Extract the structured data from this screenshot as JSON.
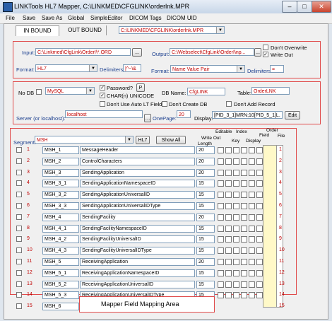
{
  "window": {
    "title": "LINKTools HL7 Mapper, C:\\LINKMED\\CFGLINK\\orderlnk.MPR"
  },
  "menu": [
    "File",
    "Save",
    "Save As",
    "Global",
    "SimpleEditor",
    "DICOM Tags",
    "DICOM UID"
  ],
  "tabs": {
    "inbound": "IN BOUND",
    "outbound": "OUT BOUND"
  },
  "file_path": "C:\\LINKMED\\CFGLINK\\orderlnk.MPR",
  "input": {
    "label": "Input:",
    "value": "C:\\Linkmed\\CfgLink\\OrderI\\*.ORD",
    "browse": "...",
    "format_label": "Format:",
    "format_value": "HL7",
    "delim_label": "Delimiters:",
    "delim_value": "|^~\\&"
  },
  "output": {
    "label": "Output:",
    "value": "C:\\Webselect\\CfgLink\\OrderI\\np...",
    "browse": "...",
    "dont_overwrite": "Don't Overwrite",
    "write_out": "Write Out",
    "format_label": "Format:",
    "format_value": "Name Value Pair",
    "delim_label": "Delimiters:",
    "delim_value": "="
  },
  "db": {
    "nodb": "No DB",
    "type_value": "MySQL",
    "password": "Password?",
    "p_button": "P",
    "char_unicode": "CHAR(n) UNICODE",
    "dont_auto_lt": "Don't Use Auto LT Fields",
    "dbname_label": "DB Name:",
    "dbname_value": "CfgLINK",
    "table_label": "Table:",
    "table_value": "OrderLNK",
    "dont_create": "Don't Create DB",
    "dont_add": "Don't Add Record",
    "server_label": "Server (or localhost):",
    "server_value": "localhost",
    "onepage_label": "OnePage:",
    "onepage_value": "20",
    "display_label": "Display:",
    "display_value": "[PID_3_1]MRN;10[PID_5_1]L.",
    "edit": "Edit"
  },
  "mapper": {
    "segment_label": "Segment:",
    "segment_value": "MSH",
    "hl7_button": "HL7",
    "show_all": "Show All",
    "headers": {
      "editable": "Editable",
      "index": "Index",
      "order": "Order",
      "write_out": "Write Out",
      "length": "Length",
      "key": "Key",
      "display": "Display",
      "field": "Field",
      "file": "File"
    },
    "rows": [
      {
        "n": "1",
        "name": "MSH_1",
        "desc": "MessageHeader",
        "len": "20",
        "ord": "1"
      },
      {
        "n": "2",
        "name": "MSH_2",
        "desc": "ControlCharacters",
        "len": "20",
        "ord": "2"
      },
      {
        "n": "3",
        "name": "MSH_3",
        "desc": "SendingApplication",
        "len": "20",
        "ord": "3"
      },
      {
        "n": "4",
        "name": "MSH_3_1",
        "desc": "SendingApplicationNamespaceID",
        "len": "15",
        "ord": "4"
      },
      {
        "n": "5",
        "name": "MSH_3_2",
        "desc": "SendingApplicationUniversalID",
        "len": "15",
        "ord": "5"
      },
      {
        "n": "6",
        "name": "MSH_3_3",
        "desc": "SendingApplicationUniversalIDType",
        "len": "15",
        "ord": "6"
      },
      {
        "n": "7",
        "name": "MSH_4",
        "desc": "SendingFacility",
        "len": "20",
        "ord": "7"
      },
      {
        "n": "8",
        "name": "MSH_4_1",
        "desc": "SendingFacilityNamespaceID",
        "len": "15",
        "ord": "8"
      },
      {
        "n": "9",
        "name": "MSH_4_2",
        "desc": "SendingFacilityUniversalID",
        "len": "15",
        "ord": "9"
      },
      {
        "n": "10",
        "name": "MSH_4_3",
        "desc": "SendingFacilityUniversalIDType",
        "len": "15",
        "ord": "10"
      },
      {
        "n": "11",
        "name": "MSH_5",
        "desc": "ReceivingApplication",
        "len": "20",
        "ord": "11"
      },
      {
        "n": "12",
        "name": "MSH_5_1",
        "desc": "ReceivingApplicationNamespaceID",
        "len": "15",
        "ord": "12"
      },
      {
        "n": "13",
        "name": "MSH_5_2",
        "desc": "ReceivingApplicationUniversalID",
        "len": "15",
        "ord": "13"
      },
      {
        "n": "14",
        "name": "MSH_5_3",
        "desc": "ReceivingApplicationUniversalIDType",
        "len": "15",
        "ord": "14"
      },
      {
        "n": "15",
        "name": "MSH_6",
        "desc": "",
        "len": "",
        "ord": "15"
      }
    ]
  },
  "callout": "Mapper Field Mapping Area"
}
